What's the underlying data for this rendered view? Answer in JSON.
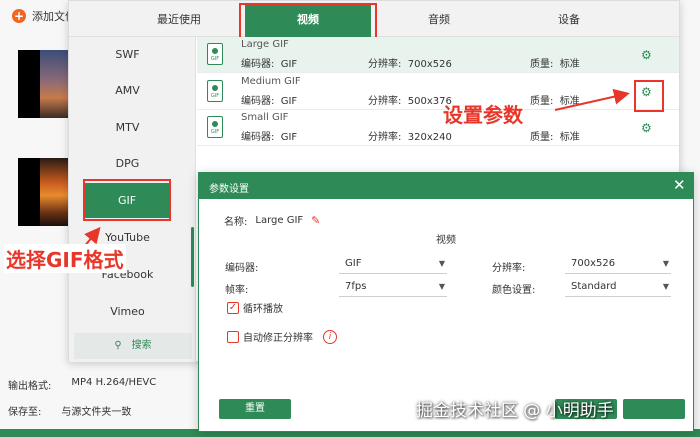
{
  "app": {
    "add_file_label": "添加文件",
    "output_format_label": "输出格式:",
    "output_format_value": "MP4 H.264/HEVC",
    "save_to_label": "保存至:",
    "save_to_value": "与源文件夹一致"
  },
  "tabs": [
    "最近使用",
    "视频",
    "音频",
    "设备"
  ],
  "active_tab": "视频",
  "formats": [
    "SWF",
    "AMV",
    "MTV",
    "DPG",
    "GIF",
    "YouTube",
    "Facebook",
    "Vimeo"
  ],
  "selected_format": "GIF",
  "search_label": "搜索",
  "presets": [
    {
      "name": "Large GIF",
      "encoder_label": "编码器:",
      "encoder": "GIF",
      "resolution_label": "分辨率:",
      "resolution": "700x526",
      "quality_label": "质量:",
      "quality": "标准"
    },
    {
      "name": "Medium GIF",
      "encoder_label": "编码器:",
      "encoder": "GIF",
      "resolution_label": "分辨率:",
      "resolution": "500x376",
      "quality_label": "质量:",
      "quality": "标准"
    },
    {
      "name": "Small GIF",
      "encoder_label": "编码器:",
      "encoder": "GIF",
      "resolution_label": "分辨率:",
      "resolution": "320x240",
      "quality_label": "质量:",
      "quality": "标准"
    }
  ],
  "preset_icon_label": "GIF",
  "annotations": {
    "settings": "设置参数",
    "choose_gif": "选择GIF格式"
  },
  "dialog": {
    "title": "参数设置",
    "name_label": "名称:",
    "name_value": "Large GIF",
    "section_video": "视频",
    "encoder_label": "编码器:",
    "encoder_value": "GIF",
    "resolution_label": "分辨率:",
    "resolution_value": "700x526",
    "fps_label": "帧率:",
    "fps_value": "7fps",
    "color_label": "颜色设置:",
    "color_value": "Standard",
    "loop_label": "循环播放",
    "loop_checked": true,
    "auto_fix_label": "自动修正分辨率",
    "auto_fix_checked": false,
    "reset_label": "重置"
  },
  "watermark": "掘金技术社区 @ 小明助手",
  "colors": {
    "accent": "#2e8b57",
    "highlight": "#e8372a"
  }
}
